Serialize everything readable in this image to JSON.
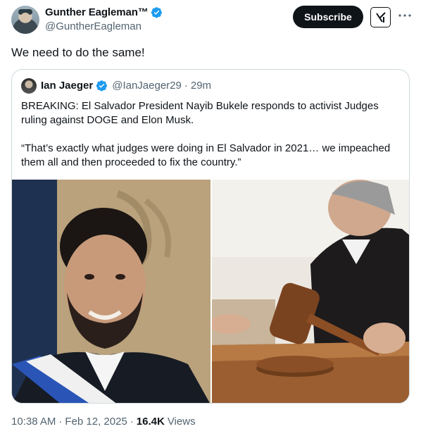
{
  "post": {
    "author": {
      "name": "Gunther Eagleman™",
      "handle": "@GuntherEagleman",
      "verified": true,
      "avatar_icon": "avatar-photo"
    },
    "actions": {
      "subscribe_label": "Subscribe",
      "grok_icon": "grok-icon",
      "more_icon": "more-icon"
    },
    "text": "We need to do the same!",
    "quoted": {
      "author_name": "Ian Jaeger",
      "handle": "@IanJaeger29",
      "separator": "·",
      "time": "29m",
      "verified": true,
      "paragraph_1": "BREAKING: El Salvador President Nayib Bukele responds to activist Judges ruling against DOGE and Elon Musk.",
      "paragraph_2": "“That’s exactly what judges were doing in El Salvador in 2021… we impeached them all and then proceeded to fix the country.”",
      "images": [
        {
          "name": "portrait-photo"
        },
        {
          "name": "gavel-photo"
        }
      ]
    },
    "footer": {
      "time": "10:38 AM",
      "sep1": "·",
      "date": "Feb 12, 2025",
      "sep2": "·",
      "views_count": "16.4K",
      "views_label": "Views"
    },
    "colors": {
      "text": "#0f1419",
      "muted": "#536471",
      "verified": "#1d9bf0",
      "border": "#cfd9de"
    }
  }
}
